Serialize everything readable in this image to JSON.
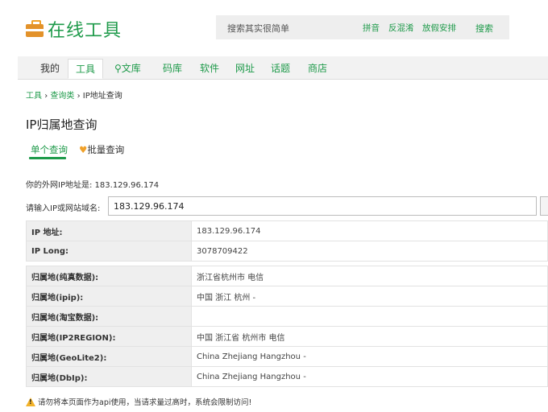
{
  "logo": {
    "text": "在线工具"
  },
  "search": {
    "placeholder": "搜索其实很简单",
    "tags": [
      "拼音",
      "反混淆",
      "放假安排"
    ],
    "button": "搜索"
  },
  "nav": {
    "items": [
      "我的",
      "工具",
      "文库",
      "码库",
      "软件",
      "网址",
      "话题",
      "商店"
    ],
    "active": "工具"
  },
  "breadcrumb": {
    "home": "工具",
    "sep": "›",
    "category": "查询类",
    "current": "IP地址查询"
  },
  "page_title": "IP归属地查询",
  "tabs": {
    "single": "单个查询",
    "batch": "批量查询"
  },
  "my_ip": {
    "label": "你的外网IP地址是:",
    "value": "183.129.96.174"
  },
  "query": {
    "label": "请输入IP或网站域名:",
    "value": "183.129.96.174"
  },
  "results_basic": [
    {
      "key": "IP 地址:",
      "value": "183.129.96.174"
    },
    {
      "key": "IP Long:",
      "value": "3078709422"
    }
  ],
  "results_geo": [
    {
      "key": "归属地(纯真数据):",
      "value": "浙江省杭州市 电信"
    },
    {
      "key": "归属地(ipip):",
      "value": "中国 浙江 杭州 -"
    },
    {
      "key": "归属地(淘宝数据):",
      "value": ""
    },
    {
      "key": "归属地(IP2REGION):",
      "value": "中国 浙江省 杭州市 电信"
    },
    {
      "key": "归属地(GeoLite2):",
      "value": "China Zhejiang Hangzhou -"
    },
    {
      "key": "归属地(DbIp):",
      "value": "China Zhejiang Hangzhou -"
    }
  ],
  "warning": "请勿将本页面作为api使用，当请求量过高时，系统会限制访问!",
  "colors": {
    "accent": "#1e9a4a",
    "logo_orange": "#e3922a"
  }
}
